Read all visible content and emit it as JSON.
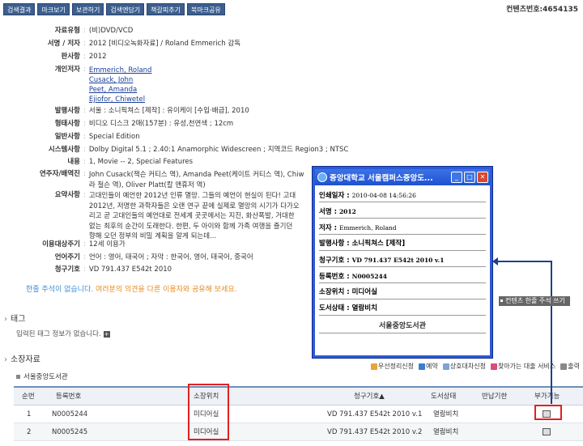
{
  "toolbar": {
    "buttons": [
      "검색결과",
      "마크보기",
      "보관하기",
      "검색엔담기",
      "책갈피추기",
      "북마크공유"
    ]
  },
  "content_id": "컨텐츠번호:4654135",
  "detail": {
    "rows": [
      {
        "label": "자료유형",
        "value": "(비)DVD/VCD"
      },
      {
        "label": "서명 / 저자",
        "value": "2012 [비디오녹화자료] / Roland Emmerich 감독"
      },
      {
        "label": "판사항",
        "value": "2012"
      },
      {
        "label": "개인저자",
        "links": [
          "Emmerich, Roland",
          "Cusack, John",
          "Peet, Amanda",
          "Ejiofor, Chiwetel"
        ]
      },
      {
        "label": "발행사항",
        "value": "서울 : 소니픽쳐스 [제작] : 유이케이 [수입·배급], 2010"
      },
      {
        "label": "형태사항",
        "value": "비디오 디스크 2매(157분) : 유성,천연색 ; 12cm"
      },
      {
        "label": "일반사항",
        "value": "Special Edition"
      },
      {
        "label": "시스템사항",
        "value": "Dolby Digital 5.1 ; 2.40:1 Anamorphic Widescreen ; 지역코드 Region3 ; NTSC"
      },
      {
        "label": "내용",
        "value": "1, Movie -- 2, Special Features"
      },
      {
        "label": "연주자/배역진",
        "value": "John Cusack(잭슨 커티스 역), Amanda Peet(케이트 커티스 역), Chiw",
        "value2": "라 철슨 역), Oliver Platt(칼 앤휴저 역)"
      },
      {
        "label": "요약사항",
        "value": "고대인들이 예언한 2012년 인류 멸망. 그들의 예언이 현실이 된다! 고대",
        "value2": "2012년, 저명한 과학자들은 오랜 연구 끝에 실제로 멸망의 시기가 다가오",
        "value3": "리고 곧 고대인들의 예언대로 전세계 곳곳에서는 지진, 화산폭발, 거대한",
        "value4": "없는 최후의 순간이 도래한다. 한편, 두 아이와 함께 가족 여행을 즐기던",
        "value5": "향해 오던 정부의 비밀 계획을 알게 되는데..."
      },
      {
        "label": "이용대상주기",
        "value": "12세 이용가"
      },
      {
        "label": "언어주기",
        "value": "언어 : 영어, 태국어 ; 자막 : 한국어, 영어, 태국어, 중국어"
      },
      {
        "label": "청구기호",
        "value": "VD 791.437 E542t 2010"
      }
    ]
  },
  "notice": {
    "part1": "한줄 주석이 없습니다.",
    "part2": "여러분의 의견을 다른 이용자와 공유해 보세요."
  },
  "tags": {
    "title": "태그",
    "empty": "입력된 태그 정보가 없습니다."
  },
  "holdings": {
    "title": "소장자료",
    "library": "서울중앙도서관",
    "legend": [
      "우선정리신청",
      "예약",
      "상호대차신청",
      "찾아가는 대출 서비스",
      "출력"
    ],
    "columns": [
      "순번",
      "등록번호",
      "소장위치",
      "청구기호▲",
      "도서상태",
      "반납기한",
      "부가기능"
    ],
    "rows": [
      {
        "no": "1",
        "reg": "N0005244",
        "loc": "미디어실",
        "call": "VD 791.437 E542t 2010 v.1",
        "status": "열람비치",
        "due": ""
      },
      {
        "no": "2",
        "reg": "N0005245",
        "loc": "미디어실",
        "call": "VD 791.437 E542t 2010 v.2",
        "status": "열람비치",
        "due": ""
      }
    ]
  },
  "popup": {
    "title": "중앙대학교 서울캠퍼스중앙도...",
    "print_date_label": "인쇄일자 : ",
    "print_date": "2010-04-08 14:56:26",
    "title_label": "서명 : ",
    "title_value": "2012",
    "author_label": "저자 : ",
    "author_value": "Emmerich, Roland",
    "publisher_label": "발행사항 : ",
    "publisher_value": "소니픽쳐스 [제작]",
    "call_label": "청구기호 : ",
    "call_value": "VD 791.437 E542t 2010 v.1",
    "reg_label": "등록번호 : ",
    "reg_value": "N0005244",
    "loc_label": "소장위치 : ",
    "loc_value": "미디어실",
    "status_label": "도서상태 : ",
    "status_value": "열람비치",
    "library": "서울중앙도서관"
  },
  "tooltip": "컨텐츠 한줄 주석 쓰기",
  "colors": {
    "toolbar_bg": "#3d5f8e",
    "link": "#1a3e9a",
    "highlight": "#e32020",
    "popup_border": "#2d5ad7"
  }
}
